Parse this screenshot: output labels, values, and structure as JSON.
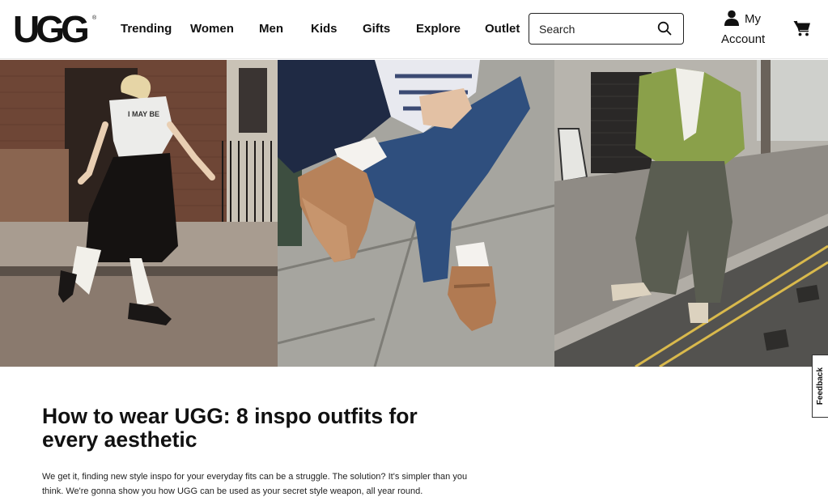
{
  "brand": {
    "logo_text": "UGG"
  },
  "nav": {
    "items": [
      {
        "label": "Trending"
      },
      {
        "label": "Women"
      },
      {
        "label": "Men"
      },
      {
        "label": "Kids"
      },
      {
        "label": "Gifts"
      },
      {
        "label": "Explore"
      },
      {
        "label": "Outlet"
      }
    ]
  },
  "search": {
    "placeholder": "Search",
    "icon": "search-icon"
  },
  "account": {
    "my": "My",
    "label": "Account",
    "icon": "person-icon"
  },
  "cart": {
    "icon": "cart-icon"
  },
  "hero": {
    "panels": [
      {
        "subject": "street-style-woman-black-skirt"
      },
      {
        "subject": "tan-suede-mary-jane-slippers"
      },
      {
        "subject": "man-green-jacket-cargo-pants"
      }
    ]
  },
  "article": {
    "title": "How to wear UGG: 8 inspo outfits for every aesthetic",
    "intro": "We get it, finding new style inspo for your everyday fits can be a struggle. The solution? It's simpler than you think. We're gonna show you how UGG can be used as your secret style weapon, all year round."
  },
  "feedback": {
    "label": "Feedback"
  }
}
